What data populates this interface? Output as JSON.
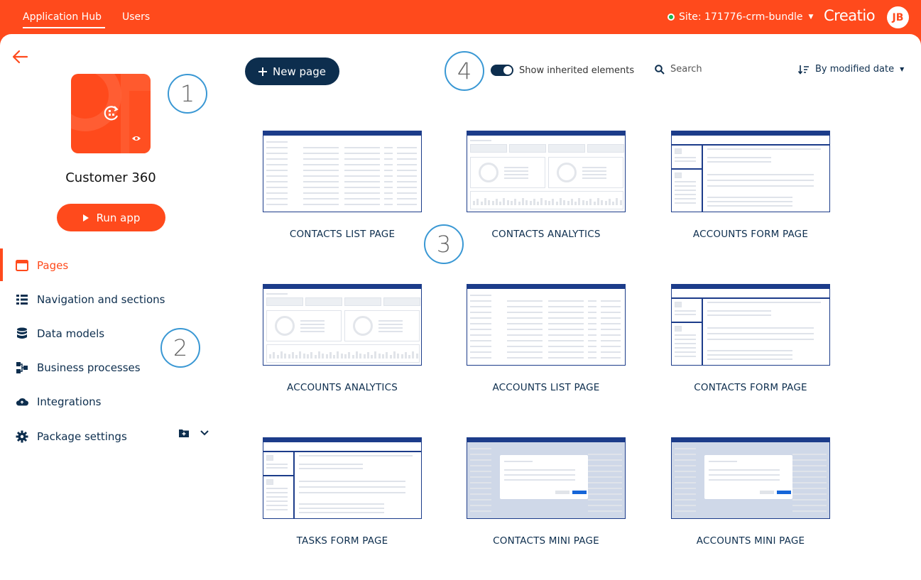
{
  "topbar": {
    "tabs": [
      {
        "label": "Application Hub",
        "active": true
      },
      {
        "label": "Users",
        "active": false
      }
    ],
    "site_label": "Site: 171776-crm-bundle",
    "site_status_color": "#18b34a",
    "logo_text": "Creatio",
    "user_initials": "JB"
  },
  "app": {
    "name": "Customer 360",
    "run_label": "Run app",
    "tile_icon": "app-settings-icon",
    "tile_badge_icon": "eye-icon"
  },
  "sidebar": {
    "items": [
      {
        "label": "Pages",
        "icon": "pages-icon",
        "active": true
      },
      {
        "label": "Navigation and sections",
        "icon": "navigation-list-icon",
        "active": false
      },
      {
        "label": "Data models",
        "icon": "database-icon",
        "active": false
      },
      {
        "label": "Business processes",
        "icon": "process-icon",
        "active": false
      },
      {
        "label": "Integrations",
        "icon": "cloud-icon",
        "active": false
      },
      {
        "label": "Package settings",
        "icon": "gear-icon",
        "active": false
      }
    ]
  },
  "toolbar": {
    "new_page_label": "New page",
    "show_inherited_label": "Show inherited elements",
    "show_inherited_on": true,
    "search_placeholder": "Search",
    "sort_label": "By modified date"
  },
  "callouts": [
    "1",
    "2",
    "3",
    "4"
  ],
  "pages": [
    {
      "label": "CONTACTS LIST PAGE",
      "kind": "list"
    },
    {
      "label": "CONTACTS ANALYTICS",
      "kind": "analytics"
    },
    {
      "label": "ACCOUNTS FORM PAGE",
      "kind": "form"
    },
    {
      "label": "ACCOUNTS ANALYTICS",
      "kind": "analytics"
    },
    {
      "label": "ACCOUNTS LIST PAGE",
      "kind": "list"
    },
    {
      "label": "CONTACTS FORM PAGE",
      "kind": "form"
    },
    {
      "label": "TASKS FORM PAGE",
      "kind": "form"
    },
    {
      "label": "CONTACTS MINI PAGE",
      "kind": "mini"
    },
    {
      "label": "ACCOUNTS MINI PAGE",
      "kind": "mini"
    }
  ],
  "colors": {
    "brand": "#ff4a1c",
    "navy": "#0d2e4e",
    "callout": "#3a98d4"
  }
}
